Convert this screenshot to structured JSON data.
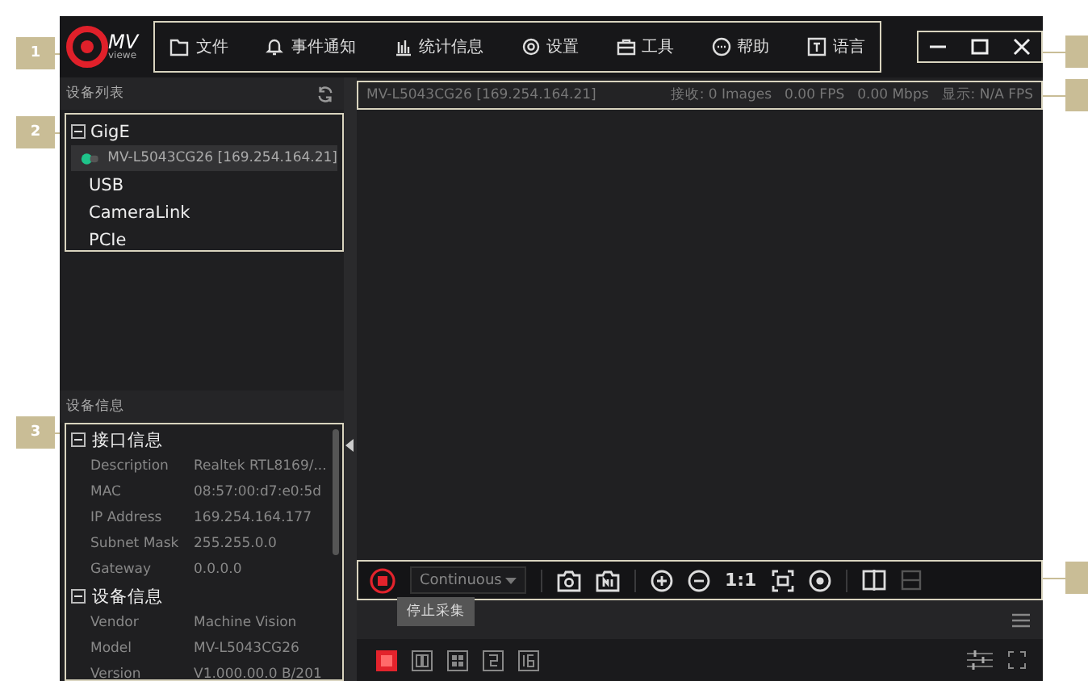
{
  "logo": {
    "text": "MV",
    "subtext": "viewe"
  },
  "menu": {
    "callout": "1",
    "items": [
      {
        "label": "文件",
        "kind": "folder"
      },
      {
        "label": "事件通知",
        "kind": "bell"
      },
      {
        "label": "统计信息",
        "kind": "bars"
      },
      {
        "label": "设置",
        "kind": "gear"
      },
      {
        "label": "工具",
        "kind": "toolbox"
      },
      {
        "label": "帮助",
        "kind": "dots"
      },
      {
        "label": "语言",
        "kind": "letter"
      }
    ]
  },
  "device_list": {
    "title": "设备列表",
    "callout": "2",
    "tree": [
      {
        "label": "GigE",
        "expanded": true,
        "children": [
          {
            "label": "MV-L5043CG26 [169.254.164.21]",
            "selected": true
          }
        ]
      },
      {
        "label": "USB"
      },
      {
        "label": "CameraLink"
      },
      {
        "label": "PCIe"
      }
    ]
  },
  "device_info": {
    "title": "设备信息",
    "callout": "3",
    "groups": [
      {
        "title": "接口信息",
        "expanded": true,
        "rows": [
          {
            "label": "Description",
            "value": "Realtek RTL8169/..."
          },
          {
            "label": "MAC",
            "value": "08:57:00:d7:e0:5d"
          },
          {
            "label": "IP Address",
            "value": "169.254.164.177"
          },
          {
            "label": "Subnet Mask",
            "value": "255.255.0.0"
          },
          {
            "label": "Gateway",
            "value": "0.0.0.0"
          }
        ]
      },
      {
        "title": "设备信息",
        "expanded": true,
        "rows": [
          {
            "label": "Vendor",
            "value": "Machine Vision"
          },
          {
            "label": "Model",
            "value": "MV-L5043CG26"
          },
          {
            "label": "Version",
            "value": "V1.000.00.0 B/201"
          }
        ]
      }
    ]
  },
  "status": {
    "device": "MV-L5043CG26 [169.254.164.21]",
    "received": "接收: 0 Images",
    "fps": "0.00 FPS",
    "bandwidth": "0.00 Mbps",
    "display": "显示: N/A FPS"
  },
  "toolbar": {
    "mode": "Continuous",
    "tooltip": "停止采集",
    "tools": [
      {
        "kind": "stop",
        "disabled": false
      },
      {
        "kind": "mode",
        "disabled": false
      },
      {
        "kind": "camera",
        "disabled": false
      },
      {
        "kind": "record",
        "disabled": false
      },
      {
        "kind": "zoom-in",
        "disabled": false
      },
      {
        "kind": "zoom-out",
        "disabled": false
      },
      {
        "kind": "ratio",
        "label": "1:1",
        "disabled": false
      },
      {
        "kind": "fit",
        "disabled": false
      },
      {
        "kind": "center",
        "disabled": false
      },
      {
        "kind": "split-v",
        "disabled": false
      },
      {
        "kind": "split-h",
        "disabled": true
      }
    ]
  },
  "layouts": [
    {
      "kind": "single",
      "selected": true
    },
    {
      "kind": "double",
      "selected": false
    },
    {
      "kind": "quad",
      "selected": false
    },
    {
      "kind": "nine",
      "selected": false
    },
    {
      "kind": "sixteen",
      "selected": false
    }
  ]
}
